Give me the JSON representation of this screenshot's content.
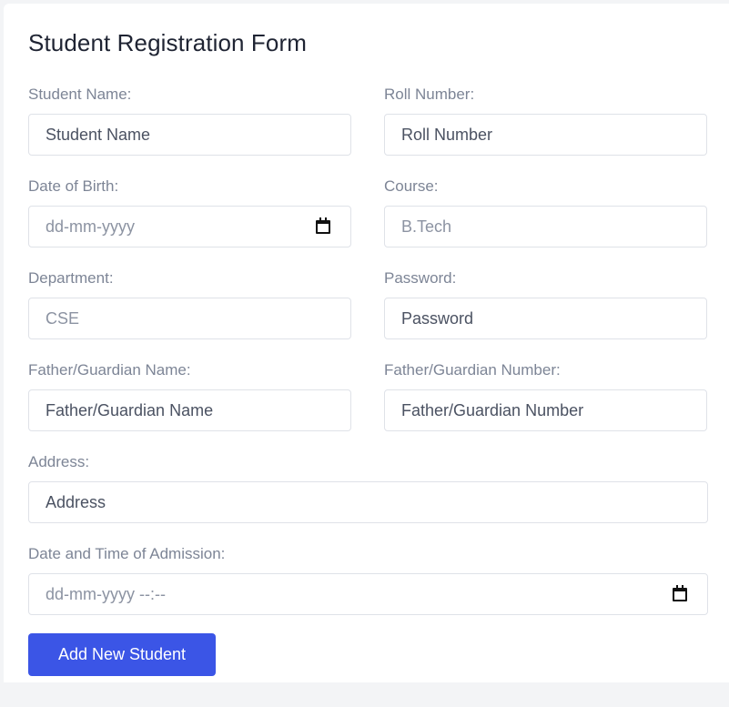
{
  "form": {
    "title": "Student Registration Form",
    "fields": {
      "student_name": {
        "label": "Student Name:",
        "placeholder": "Student Name"
      },
      "roll_number": {
        "label": "Roll Number:",
        "placeholder": "Roll Number"
      },
      "dob": {
        "label": "Date of Birth:",
        "placeholder": "dd-mm-yyyy"
      },
      "course": {
        "label": "Course:",
        "placeholder": "B.Tech"
      },
      "department": {
        "label": "Department:",
        "placeholder": "CSE"
      },
      "password": {
        "label": "Password:",
        "placeholder": "Password"
      },
      "guardian_name": {
        "label": "Father/Guardian Name:",
        "placeholder": "Father/Guardian Name"
      },
      "guardian_number": {
        "label": "Father/Guardian Number:",
        "placeholder": "Father/Guardian Number"
      },
      "address": {
        "label": "Address:",
        "placeholder": "Address"
      },
      "admission": {
        "label": "Date and Time of Admission:",
        "placeholder": "dd-mm-yyyy --:--"
      }
    },
    "submit_label": "Add New Student"
  },
  "icons": {
    "date_picker": "calendar-icon"
  },
  "colors": {
    "primary_button": "#3b55e6",
    "label_text": "#7d8596",
    "title_text": "#1f2433"
  }
}
